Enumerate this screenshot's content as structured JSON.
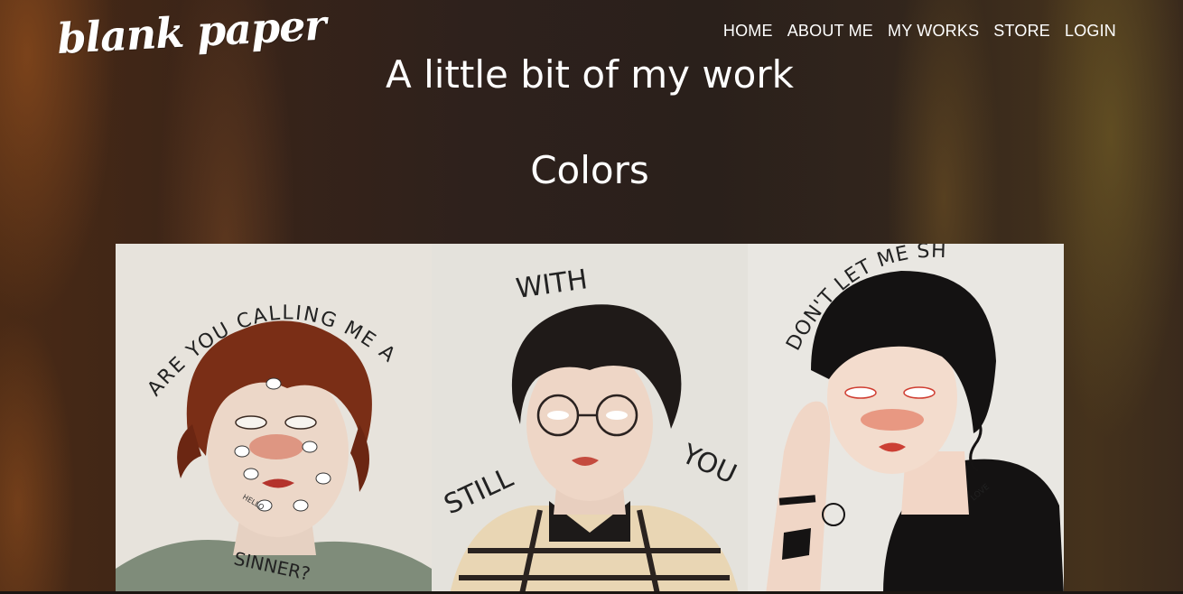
{
  "site": {
    "logo": "blank paper"
  },
  "nav": {
    "items": [
      {
        "label": "HOME"
      },
      {
        "label": "ABOUT ME"
      },
      {
        "label": "MY WORKS"
      },
      {
        "label": "STORE"
      },
      {
        "label": "LOGIN"
      }
    ]
  },
  "main": {
    "title": "A little bit of my work",
    "section_heading": "Colors",
    "gallery": [
      {
        "caption_lines": [
          "ARE YOU CALLING ME A",
          "SINNER?"
        ],
        "extra_text": "HELLO"
      },
      {
        "caption_lines": [
          "WITH",
          "STILL",
          "YOU"
        ]
      },
      {
        "caption_lines": [
          "DON'T LET ME SHINE"
        ],
        "extra_text": "LOVE"
      }
    ]
  }
}
